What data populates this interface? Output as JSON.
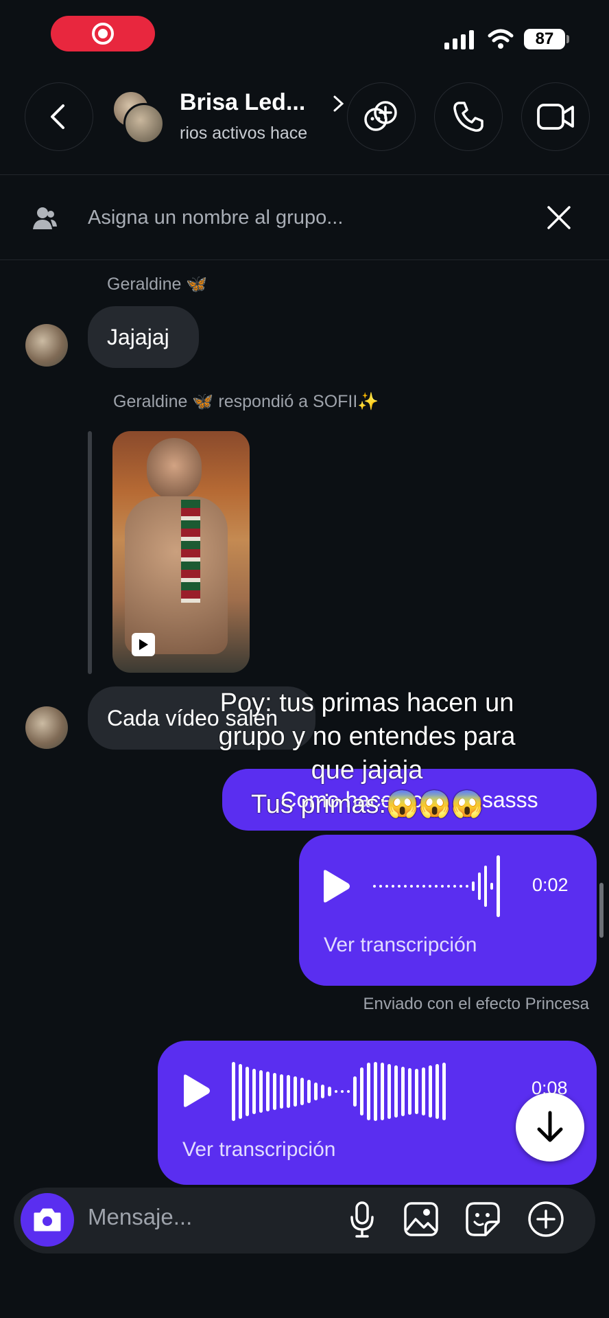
{
  "status_bar": {
    "battery": "87"
  },
  "header": {
    "name": "Brisa Led...",
    "subtitle": "rios activos hace"
  },
  "group_banner": {
    "placeholder": "Asigna un nombre al grupo..."
  },
  "messages": {
    "m1_sender": "Geraldine 🦋",
    "m1_text": "Jajajaj",
    "reply_label": "Geraldine 🦋 respondió a SOFII✨",
    "m3_text": "Cada vídeo salen",
    "m4_text": "Como hacen ca    cesasss",
    "audio1_duration": "0:02",
    "audio1_transcript": "Ver transcripción",
    "effect_note": "Enviado con el efecto Princesa",
    "audio2_duration": "0:08",
    "audio2_transcript": "Ver transcripción"
  },
  "overlay_caption": {
    "line1": "Poy: tus primas hacen un",
    "line2": "grupo y no entendes  para",
    "line3": "que jajaja",
    "line4": "Tus primas:😱😱😱"
  },
  "composer": {
    "placeholder": "Mensaje..."
  },
  "colors": {
    "accent": "#5a2ef0",
    "background": "#0c1014",
    "record": "#e8273e"
  }
}
